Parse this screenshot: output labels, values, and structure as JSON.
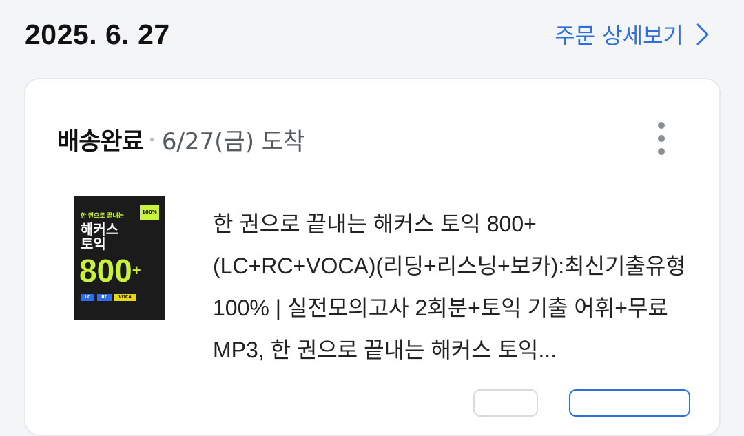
{
  "order": {
    "date": "2025. 6. 27",
    "detail_link_label": "주문 상세보기"
  },
  "shipment": {
    "status": "배송완료",
    "arrival": "6/27(금) 도착"
  },
  "product": {
    "title": "한 권으로 끝내는 해커스 토익 800+ (LC+RC+VOCA)(리딩+리스닝+보카):최신기출유형 100% | 실전모의고사 2회분+토익 기출 어휘+무료 MP3, 한 권으로 끝내는 해커스 토익...",
    "cover": {
      "line1": "한 권으로 끝내는",
      "line2": "해커스",
      "line3": "토익",
      "score": "800",
      "plus": "+",
      "badge": "100%",
      "tags": [
        "LC",
        "RC",
        "VOCA"
      ]
    }
  },
  "colors": {
    "accent": "#2e6fe0",
    "cover_bg": "#1b1b1b",
    "cover_highlight": "#c9f23b"
  },
  "icons": {
    "detail": "chevron-right-icon",
    "menu": "more-vertical-icon"
  }
}
